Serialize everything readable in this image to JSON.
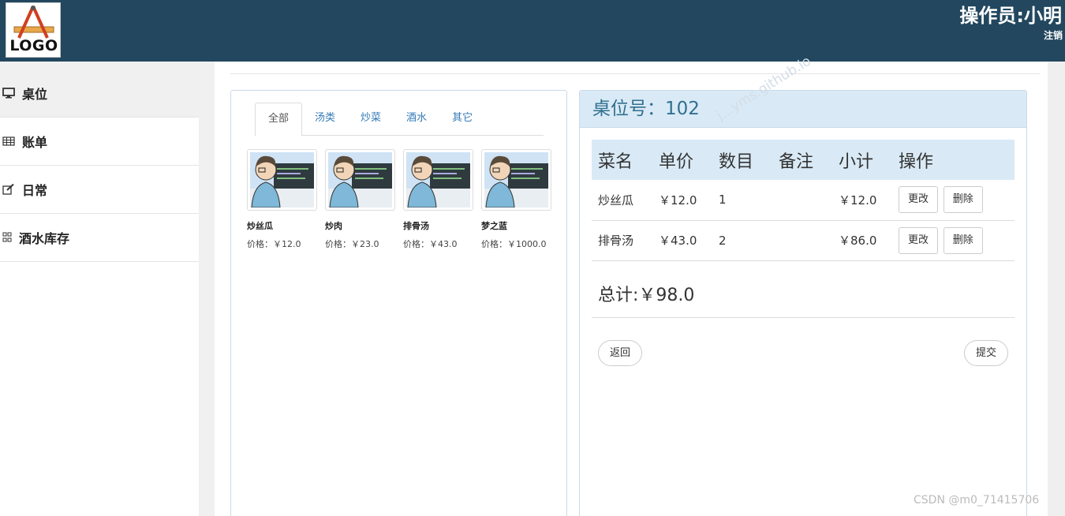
{
  "header": {
    "logo_text": "LOGO",
    "operator": "操作员:小明",
    "logout": "注销"
  },
  "sidebar": {
    "items": [
      {
        "label": "桌位",
        "icon": "monitor-icon"
      },
      {
        "label": "账单",
        "icon": "table-icon"
      },
      {
        "label": "日常",
        "icon": "edit-icon"
      },
      {
        "label": "酒水库存",
        "icon": "grid-icon"
      }
    ]
  },
  "menu": {
    "tabs": [
      "全部",
      "汤类",
      "炒菜",
      "酒水",
      "其它"
    ],
    "active_tab": "全部",
    "dishes": [
      {
        "name": "炒丝瓜",
        "price": "价格：￥12.0"
      },
      {
        "name": "炒肉",
        "price": "价格：￥23.0"
      },
      {
        "name": "排骨汤",
        "price": "价格：￥43.0"
      },
      {
        "name": "梦之蓝",
        "price": "价格：￥1000.0"
      }
    ]
  },
  "order": {
    "title": "桌位号：102",
    "headers": [
      "菜名",
      "单价",
      "数目",
      "备注",
      "小计",
      "操作"
    ],
    "rows": [
      {
        "name": "炒丝瓜",
        "price": "￥12.0",
        "qty": "1",
        "note": "",
        "subtotal": "￥12.0"
      },
      {
        "name": "排骨汤",
        "price": "￥43.0",
        "qty": "2",
        "note": "",
        "subtotal": "￥86.0"
      }
    ],
    "edit_label": "更改",
    "delete_label": "删除",
    "total": "总计:￥98.0",
    "back_label": "返回",
    "submit_label": "提交"
  },
  "watermarks": {
    "csdn": "CSDN @m0_71415706",
    "diagonal": "j...yms.github.io"
  },
  "colors": {
    "header_bg": "#22475f",
    "panel_head_bg": "#d9eaf6",
    "tab_link": "#337ab7",
    "panel_head_text": "#31708f"
  }
}
